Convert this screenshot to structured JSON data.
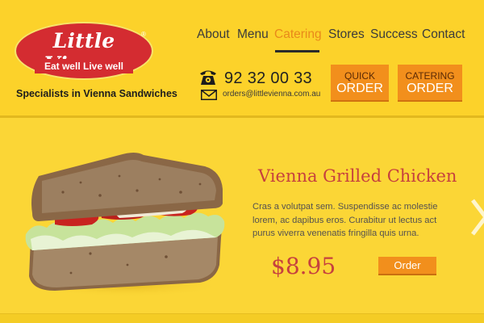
{
  "brand": {
    "name": "Little Vienna",
    "registered_mark": "®",
    "logo_tag": "Eat well Live well",
    "tagline": "Specialists in Vienna Sandwiches",
    "colors": {
      "logo_red": "#d42c31",
      "page_yellow": "#fcd22a",
      "accent_orange": "#f28f1c",
      "title_red": "#c6413e"
    }
  },
  "nav": {
    "items": [
      {
        "label": "About"
      },
      {
        "label": "Menu"
      },
      {
        "label": "Catering",
        "active": true
      },
      {
        "label": "Stores"
      },
      {
        "label": "Success"
      },
      {
        "label": "Contact"
      }
    ]
  },
  "contact": {
    "phone_icon": "telephone-icon",
    "phone": "92 32 00 33",
    "email_icon": "envelope-icon",
    "email": "orders@littlevienna.com.au"
  },
  "buttons": {
    "quick_top": "QUICK",
    "quick_bottom": "ORDER",
    "catering_top": "CATERING",
    "catering_bottom": "ORDER"
  },
  "product": {
    "image": "sandwich-photo",
    "title": "Vienna Grilled Chicken",
    "description": "Cras a volutpat sem. Suspendisse ac molestie lorem, ac dapibus eros. Curabitur ut lectus act purus viverra venenatis fringilla quis urna.",
    "price": "$8.95",
    "order_label": "Order"
  },
  "carousel": {
    "next_icon": "chevron-right-icon"
  }
}
